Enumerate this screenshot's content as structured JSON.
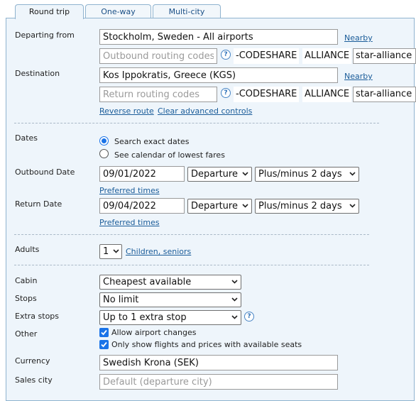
{
  "tabs": [
    {
      "label": "Round trip",
      "active": true
    },
    {
      "label": "One-way",
      "active": false
    },
    {
      "label": "Multi-city",
      "active": false
    }
  ],
  "route": {
    "departing_label": "Departing from",
    "departing_value": "Stockholm, Sweden - All airports",
    "nearby_label": "Nearby",
    "outbound_routing_placeholder": "Outbound routing codes",
    "codeshare_text": "-CODESHARE",
    "alliance_text": "ALLIANCE",
    "alliance_value": "star-alliance",
    "destination_label": "Destination",
    "destination_value": "Kos Ippokratis, Greece (KGS)",
    "return_routing_placeholder": "Return routing codes",
    "reverse_route_label": "Reverse route",
    "clear_advanced_label": "Clear advanced controls",
    "help_glyph": "?"
  },
  "dates": {
    "label": "Dates",
    "option_exact": "Search exact dates",
    "option_calendar": "See calendar of lowest fares",
    "selected": "exact",
    "outbound_label": "Outbound Date",
    "outbound_value": "09/01/2022",
    "outbound_time_mode": "Departure",
    "outbound_flex": "Plus/minus 2 days",
    "return_label": "Return Date",
    "return_value": "09/04/2022",
    "return_time_mode": "Departure",
    "return_flex": "Plus/minus 2 days",
    "preferred_times_label": "Preferred times"
  },
  "passengers": {
    "adults_label": "Adults",
    "adults_value": "1",
    "children_link": "Children, seniors"
  },
  "options": {
    "cabin_label": "Cabin",
    "cabin_value": "Cheapest available",
    "stops_label": "Stops",
    "stops_value": "No limit",
    "extra_stops_label": "Extra stops",
    "extra_stops_value": "Up to 1 extra stop",
    "other_label": "Other",
    "allow_airport_changes": "Allow airport changes",
    "allow_airport_changes_checked": true,
    "available_seats_only": "Only show flights and prices with available seats",
    "available_seats_only_checked": true,
    "currency_label": "Currency",
    "currency_value": "Swedish Krona (SEK)",
    "sales_city_label": "Sales city",
    "sales_city_placeholder": "Default (departure city)"
  },
  "colors": {
    "panel_bg": "#eef5fb",
    "border": "#8fb3cf",
    "link": "#1a5c99",
    "accent": "#1a73e8"
  }
}
